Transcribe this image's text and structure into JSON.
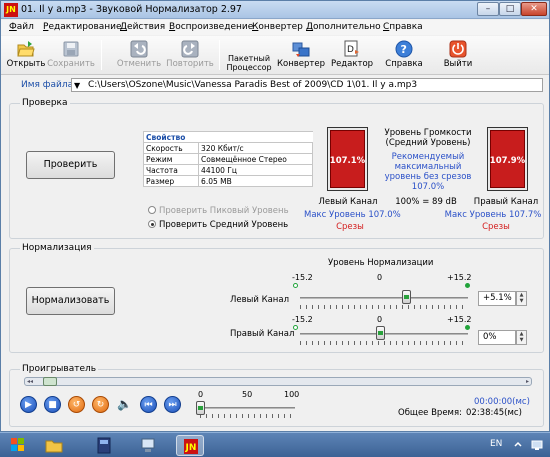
{
  "window": {
    "title": "01. Il y a.mp3 - Звуковой Нормализатор 2.97",
    "icon_text": "JN",
    "minimize_glyph": "–",
    "maximize_glyph": "□",
    "close_glyph": "✕"
  },
  "menu": [
    {
      "label": "Файл",
      "underline": "Ф",
      "rest": "айл"
    },
    {
      "label": "Редактирование",
      "underline": "Р",
      "rest": "едактирование"
    },
    {
      "label": "Действия",
      "underline": "Д",
      "rest": "ействия"
    },
    {
      "label": "Воспроизведение",
      "underline": "В",
      "rest": "оспроизведение"
    },
    {
      "label": "Конвертер",
      "underline": "К",
      "rest": "онвертер"
    },
    {
      "label": "Дополнительно",
      "underline": "Д",
      "rest": "ополнительно"
    },
    {
      "label": "Справка",
      "underline": "С",
      "rest": "правка"
    }
  ],
  "toolbar": [
    {
      "label": "Открыть",
      "icon": "folder-open-icon",
      "enabled": true
    },
    {
      "label": "Сохранить",
      "icon": "save-icon",
      "enabled": false
    },
    {
      "label": "Отменить",
      "icon": "undo-icon",
      "enabled": false
    },
    {
      "label": "Повторить",
      "icon": "redo-icon",
      "enabled": false
    },
    {
      "label": "Пакетный Процессор",
      "icon": "batch-processor-icon",
      "enabled": true
    },
    {
      "label": "Конвертер",
      "icon": "converter-icon",
      "enabled": true
    },
    {
      "label": "Редактор",
      "icon": "editor-icon",
      "enabled": true
    },
    {
      "label": "Справка",
      "icon": "help-icon",
      "enabled": true
    },
    {
      "label": "Выйти",
      "icon": "exit-icon",
      "enabled": true
    }
  ],
  "file": {
    "label": "Имя файла:",
    "path": "C:\\Users\\OSzone\\Music\\Vanessa Paradis Best of 2009\\CD 1\\01. Il y a.mp3"
  },
  "check": {
    "title": "Проверка",
    "button": "Проверить",
    "props_header": "Свойство",
    "props": [
      {
        "name": "Скорость",
        "value": "320 Кбит/с"
      },
      {
        "name": "Режим",
        "value": "Совмещённое Стерео"
      },
      {
        "name": "Частота",
        "value": "44100 Гц"
      },
      {
        "name": "Размер",
        "value": "6.05 MB"
      }
    ],
    "radio_peak": "Проверить Пиковый Уровень",
    "radio_avg": "Проверить Средний Уровень",
    "loudness_title_1": "Уровень Громкости",
    "loudness_title_2": "(Средний Уровень)",
    "recommended_1": "Рекомендуемый",
    "recommended_2": "максимальный",
    "recommended_3": "уровень без срезов",
    "recommended_value": "107.0%",
    "ratio": "100% = 89 dB",
    "left": {
      "label": "Левый Канал",
      "value": "107.1%",
      "max": "Макс Уровень 107.0%",
      "clip": "Срезы",
      "fill_fraction": 1.0
    },
    "right": {
      "label": "Правый Канал",
      "value": "107.9%",
      "max": "Макс Уровень 107.7%",
      "clip": "Срезы",
      "fill_fraction": 1.0
    }
  },
  "normalize": {
    "title": "Нормализация",
    "button": "Нормализовать",
    "header": "Уровень Нормализации",
    "scale_min": "-15.2",
    "scale_mid": "0",
    "scale_max": "+15.2",
    "left_label": "Левый Канал",
    "right_label": "Правый Канал",
    "left_value": "+5.1%",
    "right_value": "0%",
    "spin_up": "▲",
    "spin_down": "▼"
  },
  "player": {
    "title": "Проигрыватель",
    "seek_left": "◂◂",
    "seek_right": "▸",
    "btn_play": "▶",
    "btn_stop": "■",
    "btn_loop": "↺",
    "btn_repeat": "↻",
    "btn_volume": "🔈",
    "btn_prev": "⏮",
    "btn_next": "⏭",
    "vol_0": "0",
    "vol_50": "50",
    "vol_100": "100",
    "current_time": "00:00:00(мс)",
    "total_label": "Общее Время:",
    "total_time": "02:38:45(мс)"
  },
  "taskbar": {
    "lang": "EN"
  }
}
